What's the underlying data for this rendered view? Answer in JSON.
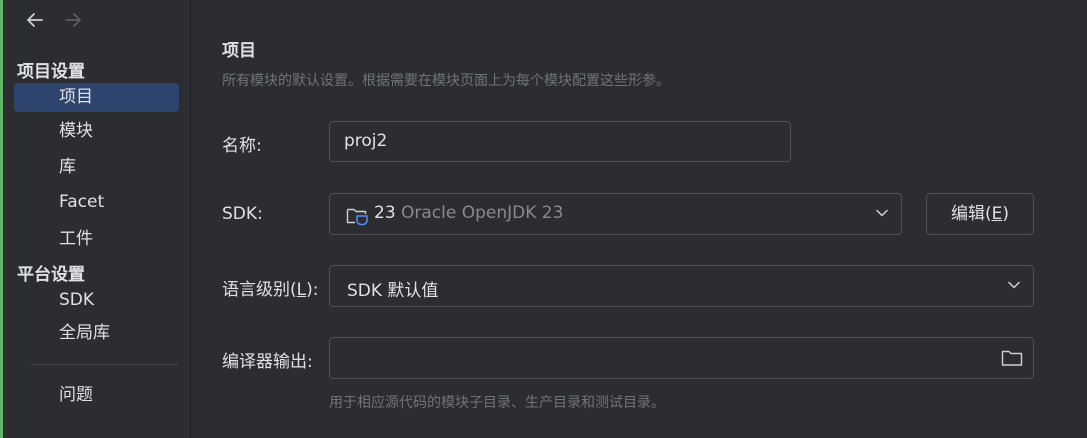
{
  "nav": {
    "back_icon": "arrow-left-icon",
    "forward_icon": "arrow-right-icon"
  },
  "sidebar": {
    "project_settings_header": "项目设置",
    "items": [
      {
        "label": "项目",
        "selected": true
      },
      {
        "label": "模块"
      },
      {
        "label": "库"
      },
      {
        "label": "Facet"
      },
      {
        "label": "工件"
      }
    ],
    "platform_settings_header": "平台设置",
    "platform_items": [
      {
        "label": "SDK"
      },
      {
        "label": "全局库"
      }
    ],
    "problems_label": "问题"
  },
  "main": {
    "title": "项目",
    "subtitle": "所有模块的默认设置。根据需要在模块页面上为每个模块配置这些形参。",
    "name_label": "名称:",
    "name_value": "proj2",
    "sdk_label": "SDK:",
    "sdk_version": "23",
    "sdk_name": "Oracle OpenJDK 23",
    "sdk_edit_button_prefix": "编辑(",
    "sdk_edit_button_mnemonic": "E",
    "sdk_edit_button_suffix": ")",
    "language_level_label_prefix": "语言级别(",
    "language_level_label_mnemonic": "L",
    "language_level_label_suffix": "):",
    "language_level_value": "SDK 默认值",
    "compiler_output_label": "编译器输出:",
    "compiler_output_value": "",
    "compiler_output_hint": "用于相应源代码的模块子目录、生产目录和测试目录。"
  },
  "colors": {
    "background": "#2b2d30",
    "selected_item": "#2e436e",
    "accent_green": "#5fb865",
    "border": "#4e5157",
    "muted_text": "#6f737a"
  }
}
